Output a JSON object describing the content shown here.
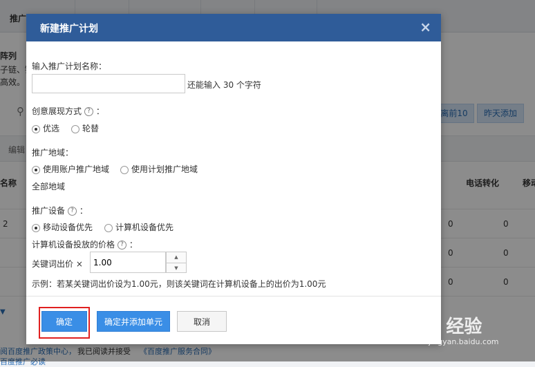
{
  "background": {
    "header_col1": "推广",
    "panel_title": "阵列",
    "panel_line1": "子链、链",
    "panel_line2": "高效。",
    "edit_label": "编辑",
    "btn_top10": "离前10",
    "btn_yesterday": "昨天添加",
    "col_name": "名称",
    "col_phone": "电话转化",
    "col_mobile": "移动",
    "row1_val": "2",
    "row_values": [
      "0",
      "0",
      "0"
    ],
    "footer_link1": "阅百度推广政策中心，",
    "footer_text": "我已阅读并接受",
    "footer_link2": "《百度推广服务合同》",
    "footer_link3": "百度推广必读"
  },
  "dialog": {
    "title": "新建推广计划",
    "close_icon": "×",
    "plan_name_label": "输入推广计划名称：",
    "plan_name_value": "",
    "plan_name_hint": "还能输入 30 个字符",
    "display_label": "创意展现方式",
    "display_colon": "：",
    "display_options": [
      "优选",
      "轮替"
    ],
    "display_selected": "优选",
    "region_label": "推广地域：",
    "region_options": [
      "使用账户推广地域",
      "使用计划推广地域"
    ],
    "region_selected": "使用账户推广地域",
    "region_value": "全部地域",
    "device_label": "推广设备",
    "device_colon": "：",
    "device_options": [
      "移动设备优先",
      "计算机设备优先"
    ],
    "device_selected": "移动设备优先",
    "pc_price_label": "计算机设备投放的价格",
    "pc_price_colon": "：",
    "keyword_bid_label": "关键词出价 ×",
    "keyword_bid_value": "1.00",
    "example_text": "示例：若某关键词出价设为1.00元，则该关键词在计算机设备上的出价为1.00元",
    "confirm_button": "确定",
    "confirm_add_unit_button": "确定并添加单元",
    "cancel_button": "取消"
  },
  "watermark": {
    "logo": "Bai 经验",
    "url": "jingyan.baidu.com"
  },
  "colors": {
    "dialog_header": "#2f5c99",
    "primary_button": "#3a8ee6",
    "highlight_box": "#e02020"
  }
}
